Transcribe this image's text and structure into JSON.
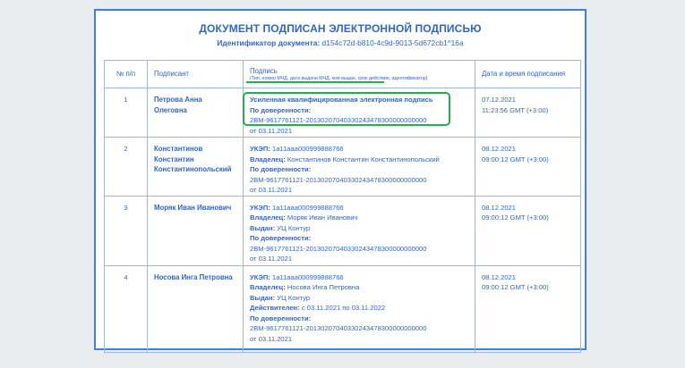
{
  "document": {
    "title": "ДОКУМЕНТ ПОДПИСАН ЭЛЕКТРОННОЙ ПОДПИСЬЮ",
    "identifier_label": "Идентификатор документа:",
    "identifier_value": "d154c72d-b810-4c9d-9013-5d672cb1^16a"
  },
  "table": {
    "headers": {
      "num": "№ п/п",
      "signer": "Подписант",
      "signature": "Подпись",
      "signature_hint": "(Тип, номер МЧД, дата выдачи МЧД, кем выдан, срок действия, идентификатор)",
      "datetime": "Дата и время подписания"
    },
    "rows": [
      {
        "num": "1",
        "signer_line1": "Петрова Анна",
        "signer_line2": "Олеговна",
        "signer_line3": "",
        "sig_type": "Усиленная квалифицированная электронная подпись",
        "poa_label": "По доверенности:",
        "poa_number": "2ВМ-9617761121-20130207040330243478300000000000",
        "poa_date": "от 03.11.2021",
        "date": "07.12.2021",
        "time": "11:23:56 GMT (+3:00)"
      },
      {
        "num": "2",
        "signer_line1": "Константинов",
        "signer_line2": "Константин",
        "signer_line3": "Константинопольский",
        "ukep_label": "УКЭП:",
        "ukep_value": "1а11ааа000999888766",
        "owner_label": "Владелец:",
        "owner_value": "Константинов Константин Константинопольский",
        "poa_label": "По доверенности:",
        "poa_number": "2ВМ-9617761121-20130207040330243478300000000000",
        "poa_date": "от 03.11.2021",
        "date": "08.12.2021",
        "time": "09:00:12 GMT (+3:00)"
      },
      {
        "num": "3",
        "signer_line1": "Моряк Иван Иванович",
        "ukep_label": "УКЭП:",
        "ukep_value": "1а11ааа000999888766",
        "owner_label": "Владелец:",
        "owner_value": "Моряк Иван Иванович",
        "issued_label": "Выдан:",
        "issued_value": "УЦ Контур",
        "poa_label": "По доверенности:",
        "poa_number": "2ВМ-9617761121-20130207040330243478300000000000",
        "poa_date": "от 03.11.2021",
        "date": "08.12.2021",
        "time": "09:00:12 GMT (+3:00)"
      },
      {
        "num": "4",
        "signer_line1": "Носова Инга Петровна",
        "ukep_label": "УКЭП:",
        "ukep_value": "1а11ааа000999888766",
        "owner_label": "Владелец:",
        "owner_value": "Носова Инга Петровна",
        "issued_label": "Выдан:",
        "issued_value": "УЦ Контур",
        "valid_label": "Действителен:",
        "valid_value": "с 03.11.2021 по 03.11.2022",
        "poa_label": "По доверенности:",
        "poa_number": "2ВМ-9617761121-20130207040330243478300000000000",
        "poa_date": "от 03.11.2021",
        "date": "08.12.2021",
        "time": "09:00:12 GMT (+3:00)"
      }
    ]
  },
  "colors": {
    "stamp_blue": "#2f66c8",
    "frame_blue": "#3f7fe0",
    "highlight_green": "#22b04b",
    "background": "#eaedf0"
  }
}
